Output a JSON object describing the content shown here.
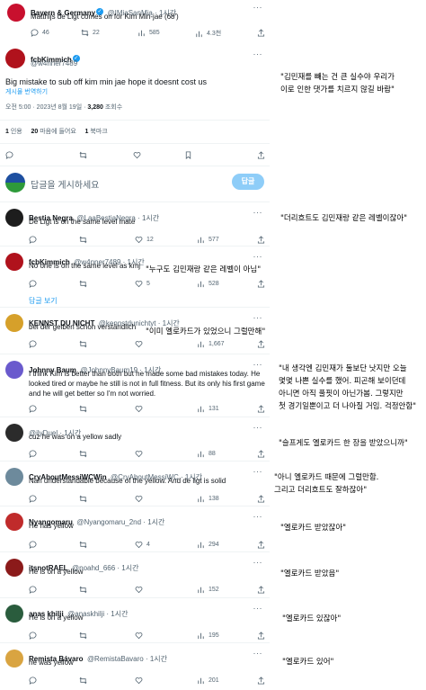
{
  "colors": {
    "accent": "#1d9bf0",
    "text": "#0f1419",
    "muted": "#536471",
    "divider": "#eff3f4"
  },
  "top_tweet": {
    "name": "Bayern & Germany",
    "handle": "@IMiaSanMia · 1시간",
    "text": "Matthijs de Ligt comes on for Kim Min-jae (68')",
    "replies": "46",
    "retweets": "22",
    "views": "585",
    "count4": "4.3천"
  },
  "main_tweet": {
    "name": "fcbKimmich",
    "handle": "@w4nner7489",
    "text": "Big mistake to sub off kim min jae hope it doesnt cost us",
    "translate": "게시물 번역하기",
    "meta": "오전 5:00 · 2023년 8월 19일 · ",
    "views_count": "3,280",
    "views_label": " 조회수",
    "stats": [
      {
        "num": "1",
        "label": " 인용"
      },
      {
        "num": "20",
        "label": " 마음에 들어요"
      },
      {
        "num": "1",
        "label": " 북마크"
      }
    ]
  },
  "compose": {
    "placeholder": "답글을 게시하세요",
    "button": "답글"
  },
  "show_replies": "답글 보기",
  "replies": [
    {
      "name": "Bestia Negra",
      "handle": "@LaaBestiaNegra · 1시간",
      "text": "De Ligt is on the same level mate",
      "c1": "",
      "c2": "12",
      "c3": "577"
    },
    {
      "name": "fcbKimmich",
      "handle": "@w4nner7489 · 1시간",
      "text": "No one is on the same level as kmj",
      "c1": "",
      "c2": "5",
      "c3": "528"
    },
    {
      "name": "KENNST DU NICHT",
      "handle": "@kennstdunichtyt · 1시간",
      "text": "bei der gelben schon verständlich",
      "c1": "",
      "c2": "",
      "c3": "1,667"
    },
    {
      "name": "Johnny Baum",
      "handle": "@JohnnyBaum19 · 1시간",
      "lines": [
        "I think Kim is better than both but he made some bad mistakes today. He",
        "looked tired or maybe he still is not in full fitness. But its only his first game",
        "and he will get better so I'm not worried."
      ],
      "c1": "",
      "c2": "",
      "c3": "131"
    },
    {
      "name": "",
      "handle": "@ilyDuel · 1시간",
      "text": "cuz he was on a yellow sadly",
      "c1": "",
      "c2": "",
      "c3": "88"
    },
    {
      "name": "CryAboutMessiWCWin",
      "handle": "@CryAboutMessiWC · 1시간",
      "text": "Nah understandable because of the yellow. And de ligt is solid",
      "c1": "",
      "c2": "",
      "c3": "138"
    },
    {
      "name": "Nyangomaru",
      "handle": "@Nyangomaru_2nd · 1시간",
      "text": "He has yellow",
      "c1": "",
      "c2": "4",
      "c3": "294"
    },
    {
      "name": "itsnotRAEL",
      "handle": "@noahd_666 · 1시간",
      "text": "He is on a yellow",
      "c1": "",
      "c2": "",
      "c3": "152"
    },
    {
      "name": "anas khilji",
      "handle": "@anaskhilji · 1시간",
      "text": "He is on a yellow",
      "c1": "",
      "c2": "",
      "c3": "195"
    },
    {
      "name": "Remista Bávaro",
      "handle": "@RemistaBavaro · 1시간",
      "text": "he was yellow",
      "c1": "",
      "c2": "",
      "c3": "201"
    }
  ],
  "annotations": {
    "a1": [
      "\"김민재를 빼는 건 큰 실수야 우리가",
      "이로 인한 댓가를 치르지 않길 바람\""
    ],
    "a2": [
      "\"더리흐트도 김민재랑 같은 레벨이잖아\""
    ],
    "a3": [
      "\"누구도 김민재랑 같은 레벨이 아님\""
    ],
    "a4": [
      "\"이미 옐로카드가 있었으니 그럴만해\""
    ],
    "a5": [
      "\"내 생각엔 김민재가 둘보단 낫지만 오늘",
      "몇몇 나쁜 실수를 했어. 피곤해 보이던데",
      "아니면 아직 풀핏이 아닌가봄. 그렇지만",
      "첫 경기일뿐이고 더 나아질 거임. 걱정안함\""
    ],
    "a6": [
      "\"슬프게도 옐로카드 한 장을 받았으니까\""
    ],
    "a7": [
      "\"아니 옐로카드 때문에 그럴만함.",
      "그리고 더리흐트도 잘하잖아\""
    ],
    "a8": [
      "\"옐로카드 받았잖아\""
    ],
    "a9": [
      "\"옐로카드 받았음\""
    ],
    "a10": [
      "\"옐로카드 있잖아\""
    ],
    "a11": [
      "\"옐로카드 있어\""
    ]
  }
}
